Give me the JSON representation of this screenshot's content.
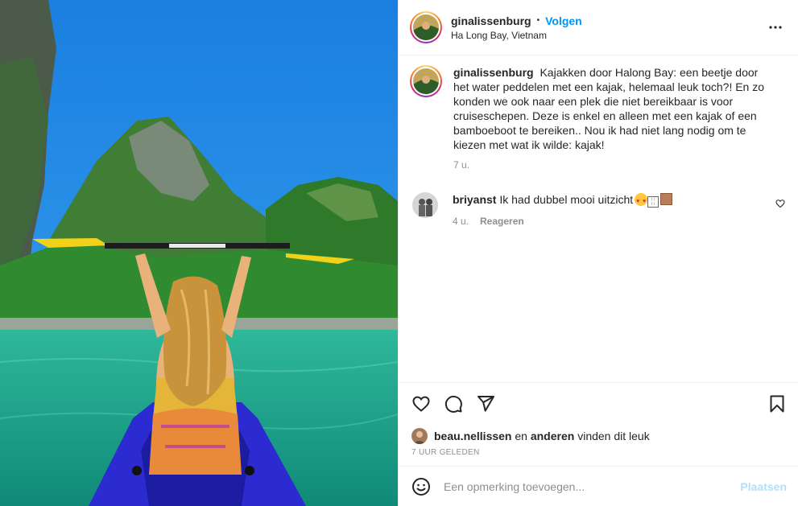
{
  "post": {
    "username": "ginalissenburg",
    "follow_label": "Volgen",
    "separator": "•",
    "location": "Ha Long Bay, Vietnam",
    "more_label": "•••",
    "photo_alt": "Kajakken door Halong Bay"
  },
  "caption": {
    "username": "ginalissenburg",
    "text": "Kajakken door Halong Bay: een beetje door het water peddelen met een kajak, helemaal leuk toch?! En zo konden we ook naar een plek die niet bereikbaar is voor cruiseschepen. Deze is enkel en alleen met een kajak of een bamboeboot te bereiken.. Nou ik had niet lang nodig om te kiezen met wat ik wilde: kajak!",
    "time": "7 u."
  },
  "comments": [
    {
      "username": "briyanst",
      "text": "Ik had dubbel mooi uitzicht",
      "time": "4 u.",
      "reply_label": "Reageren"
    }
  ],
  "likes": {
    "user": "beau.nellissen",
    "joiner": "en",
    "others": "anderen",
    "suffix": "vinden dit leuk"
  },
  "timestamp": "7 UUR GELEDEN",
  "add_comment": {
    "placeholder": "Een opmerking toevoegen...",
    "post_label": "Plaatsen"
  },
  "icons": {
    "like": "heart-icon",
    "comment": "comment-icon",
    "share": "paper-plane-icon",
    "save": "bookmark-icon",
    "emoji": "smiley-icon",
    "more": "more-options-icon"
  },
  "colors": {
    "link_blue": "#0095f6",
    "post_disabled": "#b2dffc",
    "muted": "#8e8e8e",
    "text": "#262626"
  }
}
